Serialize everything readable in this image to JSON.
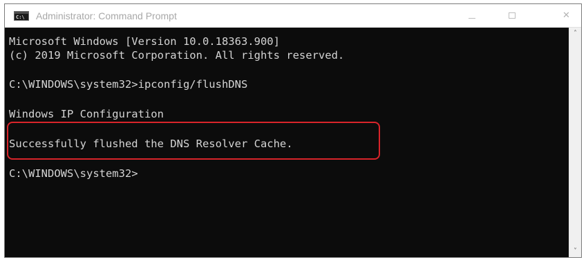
{
  "window": {
    "title": "Administrator: Command Prompt",
    "app_icon_text": "C:\\",
    "controls": {
      "minimize": "minimize-icon",
      "maximize": "maximize-icon",
      "close": "✕"
    }
  },
  "console": {
    "lines": [
      "Microsoft Windows [Version 10.0.18363.900]",
      "(c) 2019 Microsoft Corporation. All rights reserved.",
      "",
      "C:\\WINDOWS\\system32>ipconfig/flushDNS",
      "",
      "Windows IP Configuration",
      "",
      "Successfully flushed the DNS Resolver Cache.",
      "",
      "C:\\WINDOWS\\system32>"
    ],
    "highlight_color": "#d9242a"
  },
  "scrollbar": {
    "up_arrow": "˄",
    "down_arrow": "˅"
  },
  "colors": {
    "console_background": "#0c0c0c",
    "console_text": "#d4d4d4",
    "titlebar_background": "#ffffff",
    "title_text": "#a8a8a8"
  }
}
